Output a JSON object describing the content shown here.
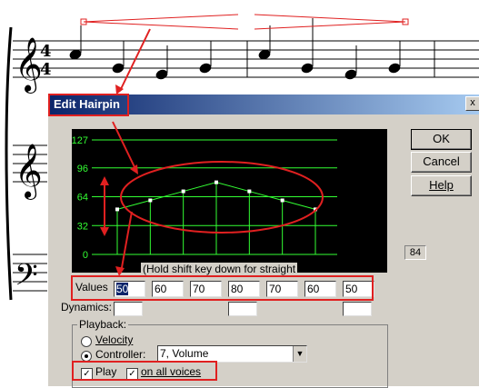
{
  "dialog": {
    "title": "Edit Hairpin",
    "close_glyph": "x",
    "ok_label": "OK",
    "cancel_label": "Cancel",
    "help_label": "Help",
    "graph_hint": "(Hold shift key down for straight",
    "side_value": "84",
    "y_axis_ticks": [
      "127",
      "96",
      "64",
      "32",
      "0"
    ],
    "graph_points": [
      50,
      60,
      70,
      80,
      70,
      60,
      50
    ],
    "values_label": "Values",
    "values": [
      "50",
      "60",
      "70",
      "80",
      "70",
      "60",
      "50"
    ],
    "dynamics_label": "Dynamics:",
    "playback": {
      "group_label": "Playback:",
      "velocity_label": "Velocity",
      "controller_label": "Controller:",
      "controller_value": "7, Volume",
      "selected": "controller",
      "play_label": "Play",
      "play_checked": true,
      "all_voices_label": "on all voices",
      "all_voices_checked": true
    }
  },
  "colors": {
    "title_bar": "#0a246a",
    "graph_bg": "#000000",
    "graph_lines": "#33ff33",
    "annotation": "#e02020"
  }
}
